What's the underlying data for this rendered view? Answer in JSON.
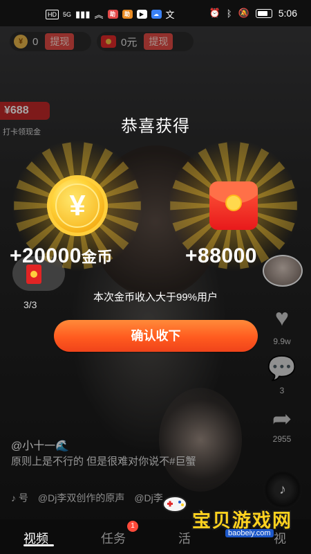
{
  "status_bar": {
    "left_icons": [
      "HD",
      "5G"
    ],
    "apps": [
      {
        "label": "助",
        "color": "#e24848"
      },
      {
        "label": "助",
        "color": "#e88a22"
      },
      {
        "label": "▶",
        "color": "#fff"
      },
      {
        "label": "☁",
        "color": "#3b82f6"
      },
      {
        "label": "文",
        "color": "none"
      }
    ],
    "time": "5:06"
  },
  "wallet": {
    "coins": "0",
    "coin_cash": "提现",
    "money": "0元",
    "money_cash": "提现"
  },
  "promo": {
    "tag": "¥688",
    "label": "打卡领现金"
  },
  "reward_dialog": {
    "title": "恭喜获得",
    "coin_reward": "+20000",
    "coin_unit": "金币",
    "redpacket_reward": "+88000",
    "subtitle": "本次金币收入大于99%用户",
    "confirm": "确认收下",
    "coin_symbol": "¥"
  },
  "left_widget": {
    "count": "3/3"
  },
  "side_actions": {
    "likes": "9.9w",
    "comments": "3",
    "shares": "2955"
  },
  "video": {
    "author": "@小十一🌊",
    "description": "原则上是不行的 但是很难对你说不#巨蟹",
    "music_prefix": "♪ 号",
    "music": "@Dj李双创作的原声",
    "music_next": "@Dj李"
  },
  "nav": {
    "tabs": [
      "视频",
      "任务",
      "活",
      "视"
    ],
    "badge": "1"
  },
  "watermark": {
    "text": "宝贝游戏网",
    "url": "baobeiy.com"
  },
  "colors": {
    "accent": "#ff5b1f",
    "gold": "#ffd21f",
    "danger": "#e22424"
  }
}
